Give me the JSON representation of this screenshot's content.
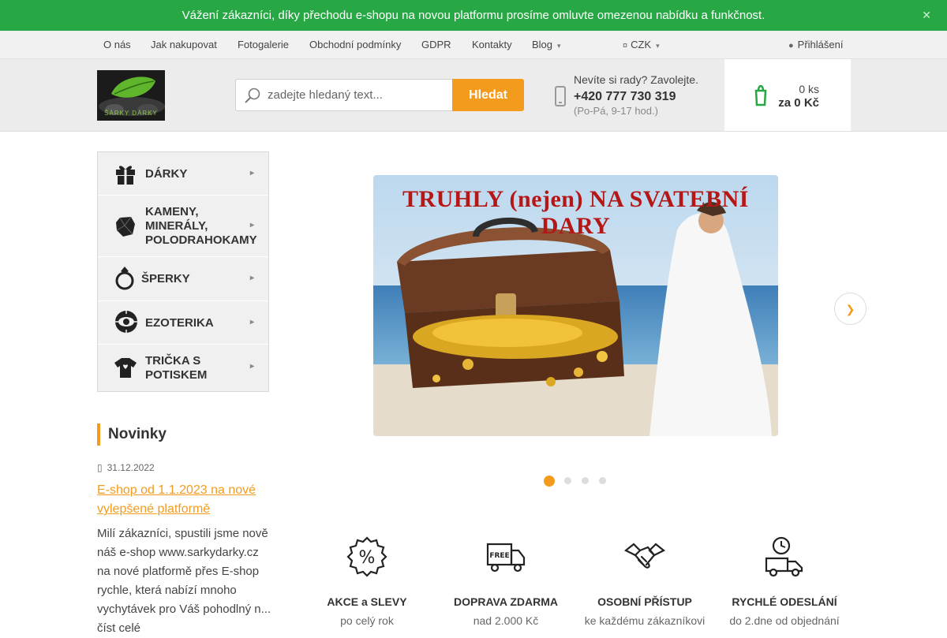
{
  "announcement": {
    "text": "Vážení zákazníci, díky přechodu e-shopu na novou platformu prosíme omluvte omezenou nabídku a funkčnost.",
    "close_icon": "close-icon"
  },
  "topnav": {
    "items": [
      "O nás",
      "Jak nakupovat",
      "Fotogalerie",
      "Obchodní podmínky",
      "GDPR",
      "Kontakty",
      "Blog"
    ],
    "currency": "CZK",
    "login": "Přihlášení"
  },
  "header": {
    "logo_text": "ŠÁRKY DÁRKY",
    "search_placeholder": "zadejte hledaný text...",
    "search_button": "Hledat",
    "help_text": "Nevíte si rady? Zavolejte.",
    "phone": "+420 777 730 319",
    "hours": "(Po-Pá, 9-17 hod.)",
    "cart_qty": "0 ks",
    "cart_price": "za 0 Kč"
  },
  "categories": [
    {
      "label": "DÁRKY",
      "icon": "gift-icon"
    },
    {
      "label": "KAMENY, MINERÁLY, POLODRAHOKAMY",
      "icon": "stone-icon"
    },
    {
      "label": "ŠPERKY",
      "icon": "ring-icon"
    },
    {
      "label": "EZOTERIKA",
      "icon": "esoteric-symbol-icon"
    },
    {
      "label": "TRIČKA S POTISKEM",
      "icon": "tshirt-icon"
    }
  ],
  "news": {
    "heading": "Novinky",
    "date": "31.12.2022",
    "title": "E-shop od 1.1.2023 na nové vylepšené platformě",
    "text": "Milí zákazníci, spustili jsme nově náš e-shop www.sarkydarky.cz na nové platformě přes E-shop rychle, která nabízí mnoho vychytávek pro Váš pohodlný n... číst celé"
  },
  "banner": {
    "title": "TRUHLY (nejen) NA SVATEBNÍ DARY",
    "slide_count": 4,
    "active_slide": 1
  },
  "features": [
    {
      "title": "AKCE a SLEVY",
      "subtitle": "po celý rok",
      "icon": "percent-badge-icon"
    },
    {
      "title": "DOPRAVA ZDARMA",
      "subtitle": "nad 2.000 Kč",
      "icon": "free-delivery-truck-icon"
    },
    {
      "title": "OSOBNÍ PŘÍSTUP",
      "subtitle": "ke každému zákazníkovi",
      "icon": "handshake-icon"
    },
    {
      "title": "RYCHLÉ ODESLÁNÍ",
      "subtitle": "do 2.dne od objednání",
      "icon": "fast-shipping-icon"
    }
  ],
  "colors": {
    "accent": "#f39b1c",
    "announcement_bg": "#27a844"
  }
}
